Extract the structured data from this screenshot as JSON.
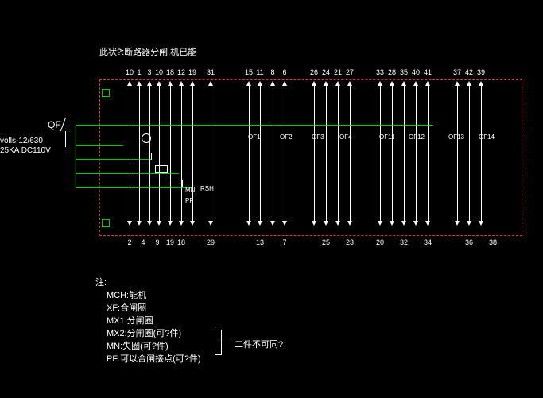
{
  "title": "此状?:断路器分闸,机已能",
  "breaker": {
    "label": "QF",
    "spec_line1": "volls-12/630",
    "spec_line2": "25KA DC110V"
  },
  "top_terminals": [
    "10",
    "1",
    "3",
    "10",
    "18",
    "12",
    "19",
    "31",
    "15",
    "11",
    "8",
    "6",
    "26",
    "24",
    "21",
    "27",
    "33",
    "28",
    "35",
    "40",
    "41",
    "37",
    "42",
    "39"
  ],
  "bot_terminals": [
    "2",
    "4",
    "9",
    "19",
    "18",
    "29",
    "13",
    "7",
    "25",
    "23",
    "20",
    "32",
    "34",
    "36",
    "38"
  ],
  "coils": {
    "mch": "MCH",
    "xf": "XF",
    "mx1": "MX1",
    "mx2": "MX2",
    "mn": "MN",
    "pf": "PF",
    "rsh": "RSH"
  },
  "contacts": [
    "OF1",
    "OF2",
    "OF3",
    "OF4",
    "OF11",
    "OF12",
    "OF13",
    "OF14"
  ],
  "notes": {
    "head": "注:",
    "l1": "MCH:能机",
    "l2": "XF:合闸圈",
    "l3": "MX1:分闸圈",
    "l4": "MX2:分闸圈(可?件)",
    "l5": "MN:失圈(可?件)",
    "l6": "PF:可以合闸接点(可?件)",
    "side": "二件不可同?"
  }
}
